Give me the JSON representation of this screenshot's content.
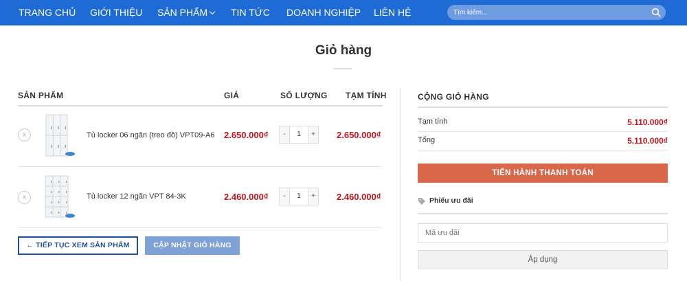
{
  "nav": {
    "items": [
      {
        "label": "TRANG CHỦ"
      },
      {
        "label": "GIỚI THIỆU"
      },
      {
        "label": "SẢN PHẨM"
      },
      {
        "label": "TIN TỨC"
      },
      {
        "label": "DOANH NGHIỆP"
      },
      {
        "label": "LIÊN HỆ"
      }
    ],
    "search_placeholder": "Tìm kiếm..."
  },
  "page": {
    "title": "Giỏ hàng"
  },
  "cart": {
    "headers": {
      "product": "SẢN PHẨM",
      "price": "GIÁ",
      "quantity": "SỐ LƯỢNG",
      "subtotal": "TẠM TÍNH"
    },
    "rows": [
      {
        "remove": "×",
        "name": "Tủ locker 06 ngăn (treo đồ) VPT09-A6",
        "price": "2.650.000₫",
        "minus": "-",
        "qty": "1",
        "plus": "+",
        "subtotal": "2.650.000₫"
      },
      {
        "remove": "×",
        "name": "Tủ locker 12 ngăn VPT 84-3K",
        "price": "2.460.000₫",
        "minus": "-",
        "qty": "1",
        "plus": "+",
        "subtotal": "2.460.000₫"
      }
    ],
    "continue_label": "← TIẾP TỤC XEM SẢN PHẨM",
    "update_label": "CẬP NHẬT GIỎ HÀNG"
  },
  "totals": {
    "title": "CỘNG GIỎ HÀNG",
    "subtotal_label": "Tạm tính",
    "subtotal_value": "5.110.000₫",
    "total_label": "Tổng",
    "total_value": "5.110.000₫",
    "checkout_label": "TIẾN HÀNH THANH TOÁN"
  },
  "coupon": {
    "heading": "Phiếu ưu đãi",
    "placeholder": "Mã ưu đãi",
    "apply_label": "Áp dụng"
  },
  "colors": {
    "nav_bg": "#1e6bd6",
    "price_red": "#c4161c",
    "checkout_orange": "#d9674a",
    "continue_blue": "#1e4f9c",
    "update_blue": "#7ea2d6"
  }
}
